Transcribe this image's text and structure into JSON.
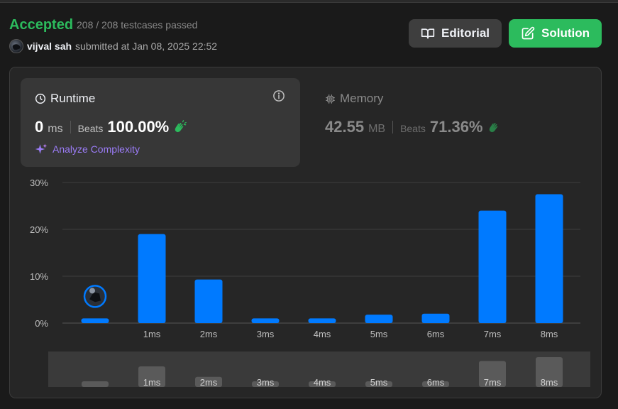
{
  "header": {
    "status": "Accepted",
    "testcases": "208 / 208 testcases passed",
    "username": "vijval sah",
    "submitted": "submitted at Jan 08, 2025 22:52",
    "editorial_label": "Editorial",
    "solution_label": "Solution"
  },
  "runtime": {
    "title": "Runtime",
    "value": "0",
    "unit": "ms",
    "beats_label": "Beats",
    "beats_pct": "100.00%",
    "analyze_label": "Analyze Complexity"
  },
  "memory": {
    "title": "Memory",
    "value": "42.55",
    "unit": "MB",
    "beats_label": "Beats",
    "beats_pct": "71.36%"
  },
  "colors": {
    "accepted": "#2cbb5d",
    "bar": "#007aff",
    "analyze": "#9b7cf7",
    "clap": "#2cbb5d"
  },
  "chart_data": {
    "type": "bar",
    "categories": [
      "",
      "1ms",
      "2ms",
      "3ms",
      "4ms",
      "5ms",
      "6ms",
      "7ms",
      "8ms"
    ],
    "values": [
      1.0,
      19.0,
      9.3,
      1.0,
      1.0,
      1.8,
      2.0,
      24.0,
      27.5
    ],
    "yticks": [
      "0%",
      "10%",
      "20%",
      "30%"
    ],
    "ylim": [
      0,
      30
    ],
    "grid": true,
    "highlight_index": 0,
    "overview_labels": [
      "",
      "1ms",
      "2ms",
      "3ms",
      "4ms",
      "5ms",
      "6ms",
      "7ms",
      "8ms"
    ]
  }
}
